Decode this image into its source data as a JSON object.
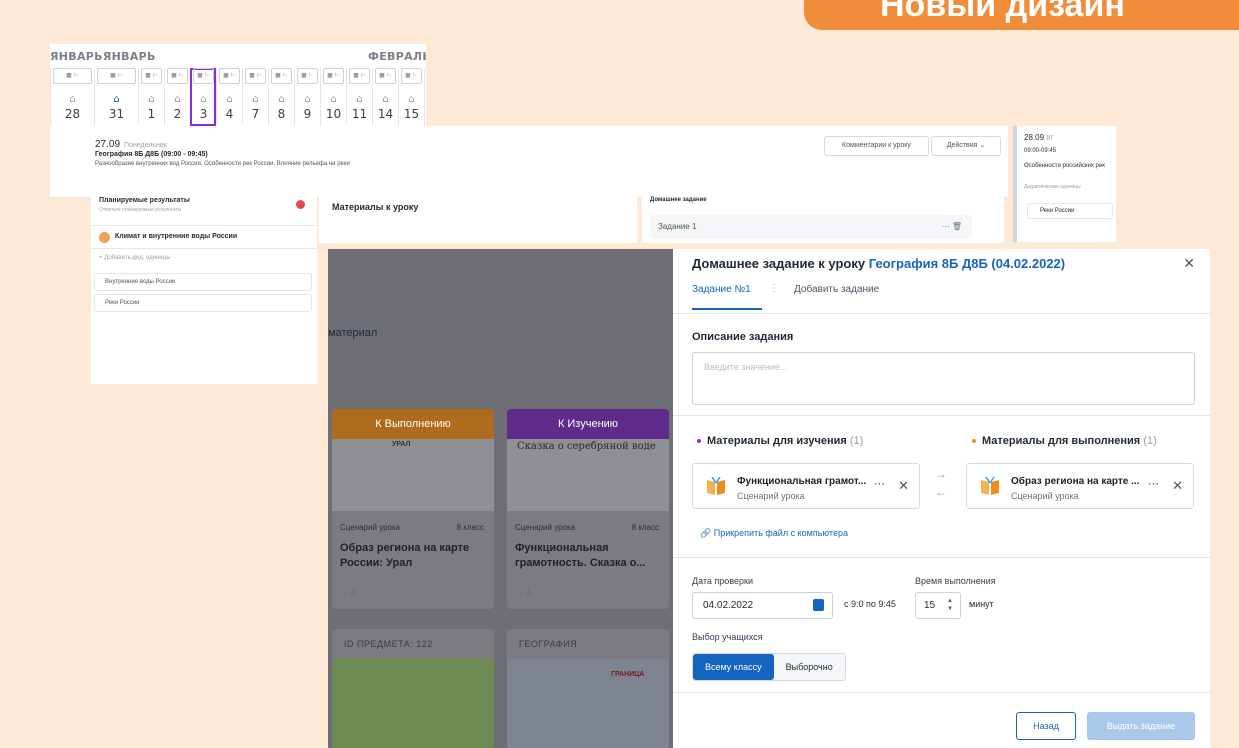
{
  "badge": "Новый дизайн",
  "calendar": {
    "month_left": "ЯНВАРЬЯНВАРЬ",
    "month_right": "ФЕВРАЛЬ",
    "days": [
      "28",
      "31",
      "1",
      "2",
      "3",
      "4",
      "7",
      "8",
      "9",
      "10",
      "11",
      "14",
      "15",
      "1"
    ],
    "selected_day": "3"
  },
  "lesson": {
    "date": "27.09",
    "weekday": "Понедельник",
    "subject": "География 8Б Д8Б (09:00 - 09:45)",
    "topic": "Разнообразие внутренних вод России. Особенности рек России. Влияние рельефа на реки",
    "comments_button": "Комментарии к уроку",
    "actions_button": "Действия"
  },
  "next_lesson": {
    "date": "28.09",
    "weekday": "ВТ",
    "time": "09:00-09:45",
    "topic": "Особенности российских рек",
    "units_label": "Дидактические единицы",
    "unit": "Реки России"
  },
  "planned": {
    "title": "Планируемые результаты",
    "subtitle": "Отметьте планируемые результаты",
    "group": "Климат и внутренние воды России",
    "add": "Добавить дид. единицы",
    "items": [
      "Внутренние воды России",
      "Реки России"
    ]
  },
  "materials_panel": {
    "title": "Материалы к уроку"
  },
  "homework_panel": {
    "title": "Домашнее задание",
    "task": "Задание 1"
  },
  "bg_page": {
    "label": "материал",
    "cards": [
      {
        "band": "К Выполнению",
        "band_color": "#f08c1a",
        "type": "Сценарий урока",
        "grade": "8 класс",
        "title": "Образ региона на карте России: Урал",
        "rating": "4",
        "img_text": "УРАЛ"
      },
      {
        "band": "К Изучению",
        "band_color": "#8a2be2",
        "type": "Сценарий урока",
        "grade": "8 класс",
        "title": "Функциональная грамотность. Сказка о...",
        "rating": "4",
        "img_text": "Сказка о серебряной воде"
      }
    ],
    "lower_cards": [
      "ID ПРЕДМЕТА: 122",
      "ГЕОГРАФИЯ"
    ],
    "lower_card_text": "ГРАНИЦА"
  },
  "modal": {
    "title_prefix": "Домашнее задание к уроку",
    "title_link": "География 8Б Д8Б (04.02.2022)",
    "tab_active": "Задание №1",
    "tab_add": "Добавить задание",
    "desc_label": "Описание задания",
    "desc_placeholder": "Введите значение...",
    "study": {
      "label": "Материалы для изучения",
      "count": "(1)",
      "color": "#8a2be2",
      "name": "Функциональная грамот...",
      "type": "Сценарий урока"
    },
    "exec": {
      "label": "Материалы для выполнения",
      "count": "(1)",
      "color": "#f08c1a",
      "name": "Образ региона на карте ...",
      "type": "Сценарий урока"
    },
    "attach": "Прикрепить файл с компьютера",
    "check_date_label": "Дата проверки",
    "check_date": "04.02.2022",
    "time_range": "с 9:0 по 9:45",
    "duration_label": "Время выполнения",
    "duration": "15",
    "duration_units": "минут",
    "students_label": "Выбор учащихся",
    "opt_all": "Всему классу",
    "opt_select": "Выборочно",
    "back": "Назад",
    "issue": "Выдать задание",
    "accent": "#1565c0"
  }
}
